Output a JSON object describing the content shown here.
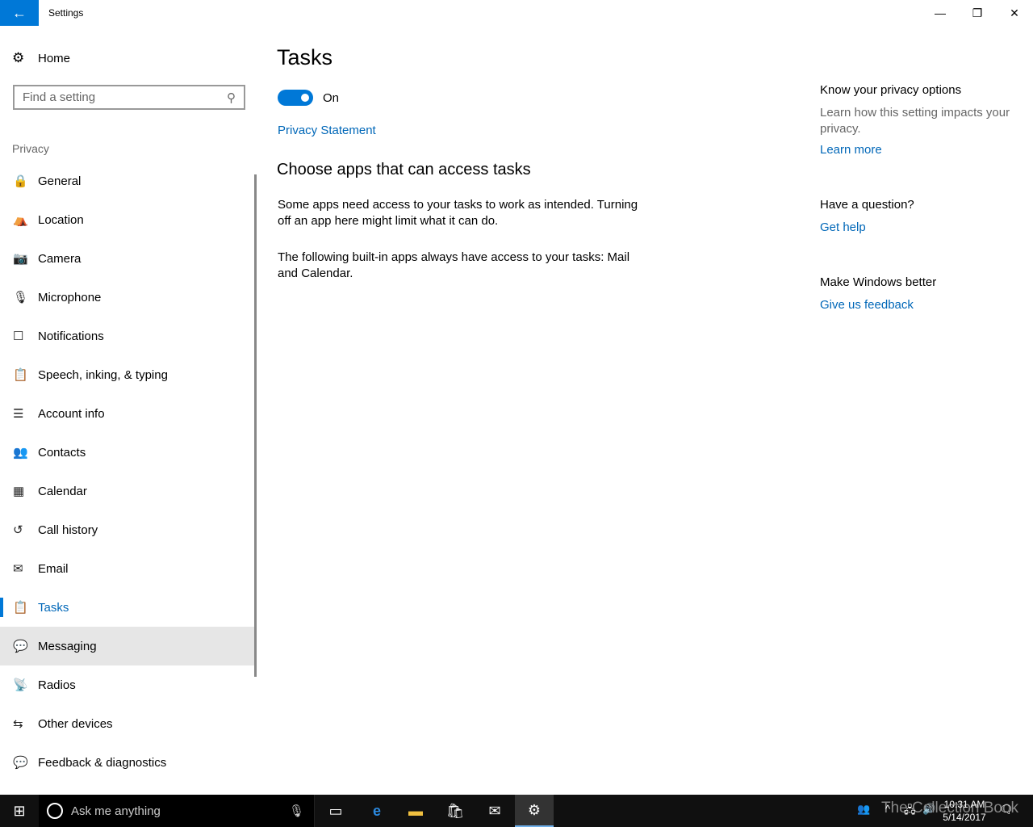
{
  "window": {
    "title": "Settings",
    "back_icon": "arrow-left-icon",
    "accent": "#0078d7"
  },
  "sidebar": {
    "home": "Home",
    "search_placeholder": "Find a setting",
    "category": "Privacy",
    "items": [
      {
        "label": "General",
        "icon": "lock-icon",
        "glyph": "🔒"
      },
      {
        "label": "Location",
        "icon": "location-icon",
        "glyph": "⛺"
      },
      {
        "label": "Camera",
        "icon": "camera-icon",
        "glyph": "📷"
      },
      {
        "label": "Microphone",
        "icon": "microphone-icon",
        "glyph": "🎙"
      },
      {
        "label": "Notifications",
        "icon": "notifications-icon",
        "glyph": "☐"
      },
      {
        "label": "Speech, inking, & typing",
        "icon": "speech-icon",
        "glyph": "📋"
      },
      {
        "label": "Account info",
        "icon": "account-info-icon",
        "glyph": "☰"
      },
      {
        "label": "Contacts",
        "icon": "contacts-icon",
        "glyph": "👥"
      },
      {
        "label": "Calendar",
        "icon": "calendar-icon",
        "glyph": "▦"
      },
      {
        "label": "Call history",
        "icon": "call-history-icon",
        "glyph": "↺"
      },
      {
        "label": "Email",
        "icon": "email-icon",
        "glyph": "✉"
      },
      {
        "label": "Tasks",
        "icon": "tasks-icon",
        "glyph": "📋",
        "selected": true
      },
      {
        "label": "Messaging",
        "icon": "messaging-icon",
        "glyph": "💬",
        "hover": true
      },
      {
        "label": "Radios",
        "icon": "radios-icon",
        "glyph": "📡"
      },
      {
        "label": "Other devices",
        "icon": "other-devices-icon",
        "glyph": "⇆"
      },
      {
        "label": "Feedback & diagnostics",
        "icon": "feedback-icon",
        "glyph": "💬"
      }
    ]
  },
  "main": {
    "title": "Tasks",
    "toggle_state": "On",
    "toggle_on": true,
    "privacy_statement": "Privacy Statement",
    "heading": "Choose apps that can access tasks",
    "para1": "Some apps need access to your tasks to work as intended. Turning off an app here might limit what it can do.",
    "para2": "The following built-in apps always have access to your tasks: Mail and Calendar."
  },
  "right": {
    "privacy_heading": "Know your privacy options",
    "privacy_text": "Learn how this setting impacts your privacy.",
    "learn_more": "Learn more",
    "question_heading": "Have a question?",
    "get_help": "Get help",
    "better_heading": "Make Windows better",
    "feedback": "Give us feedback"
  },
  "taskbar": {
    "search_placeholder": "Ask me anything",
    "time": "10:31 AM",
    "date": "5/14/2017",
    "watermark": "The Collection Book"
  }
}
